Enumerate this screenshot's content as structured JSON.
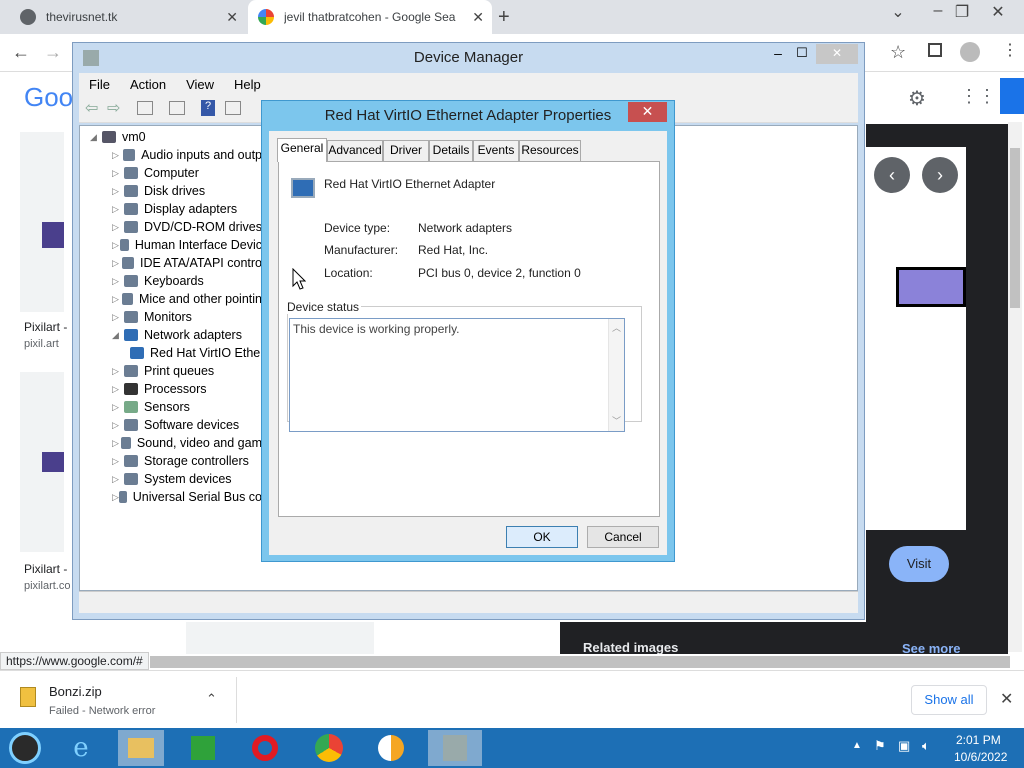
{
  "browser": {
    "tabs": [
      {
        "label": "thevirusnet.tk"
      },
      {
        "label": "jevil thatbratcohen - Google Sea"
      }
    ],
    "new_tab_icon": "plus-icon",
    "window_controls": [
      "chevron-down-icon",
      "minimize-icon",
      "restore-icon",
      "close-icon"
    ],
    "toolbar_icons": [
      "back-icon",
      "forward-icon",
      "share-icon",
      "star-icon",
      "sidebar-icon",
      "profile-icon",
      "menu-dots-icon"
    ],
    "status_url": "https://www.google.com/#"
  },
  "google_page": {
    "logo_partial": "Goo",
    "results": [
      {
        "title": "Pixilart -",
        "source": "pixil.art"
      },
      {
        "title": "Pixilart -",
        "source": "pixilart.co"
      }
    ],
    "preview": {
      "visit_label": "Visit",
      "related_label": "Related images",
      "see_more_label": "See more"
    },
    "colors": {
      "accent": "#8ab4f8",
      "dark_panel": "#202124"
    }
  },
  "download_shelf": {
    "file_name": "Bonzi.zip",
    "file_status": "Failed - Network error",
    "show_all_label": "Show all"
  },
  "device_manager": {
    "title": "Device Manager",
    "menu": [
      "File",
      "Action",
      "View",
      "Help"
    ],
    "root": "vm0",
    "nodes": [
      "Audio inputs and outp",
      "Computer",
      "Disk drives",
      "Display adapters",
      "DVD/CD-ROM drives",
      "Human Interface Devic",
      "IDE ATA/ATAPI contro",
      "Keyboards",
      "Mice and other pointin",
      "Monitors",
      "Network adapters",
      "Red Hat VirtIO Ethe",
      "Print queues",
      "Processors",
      "Sensors",
      "Software devices",
      "Sound, video and gam",
      "Storage controllers",
      "System devices",
      "Universal Serial Bus co"
    ]
  },
  "properties": {
    "title": "Red Hat VirtIO Ethernet Adapter Properties",
    "tabs": [
      "General",
      "Advanced",
      "Driver",
      "Details",
      "Events",
      "Resources"
    ],
    "device_name": "Red Hat VirtIO Ethernet Adapter",
    "fields": [
      {
        "label": "Device type:",
        "value": "Network adapters"
      },
      {
        "label": "Manufacturer:",
        "value": "Red Hat, Inc."
      },
      {
        "label": "Location:",
        "value": "PCI bus 0, device 2, function 0"
      }
    ],
    "status_group_label": "Device status",
    "status_text": "This device is working properly.",
    "ok_label": "OK",
    "cancel_label": "Cancel"
  },
  "taskbar": {
    "time": "2:01 PM",
    "date": "10/6/2022"
  }
}
